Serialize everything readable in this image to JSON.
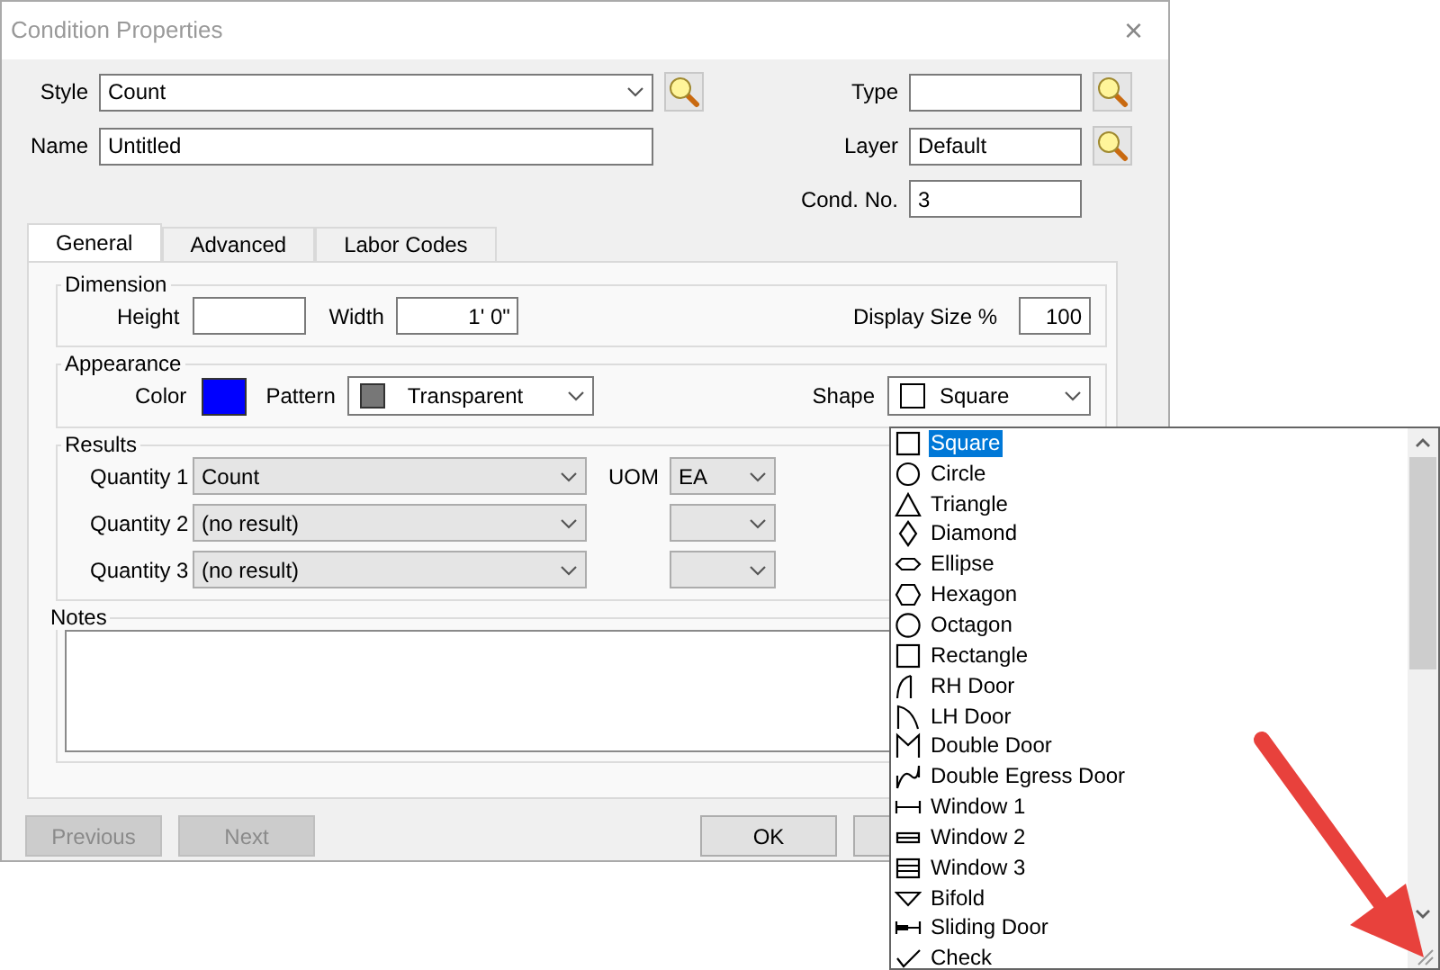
{
  "window": {
    "title": "Condition Properties",
    "close": "×"
  },
  "style": {
    "label": "Style",
    "value": "Count"
  },
  "name": {
    "label": "Name",
    "value": "Untitled"
  },
  "type": {
    "label": "Type"
  },
  "layer": {
    "label": "Layer",
    "value": "Default"
  },
  "cond_no": {
    "label": "Cond. No.",
    "value": "3"
  },
  "tabs": [
    {
      "label": "General",
      "selected": true
    },
    {
      "label": "Advanced",
      "selected": false
    },
    {
      "label": "Labor Codes",
      "selected": false
    }
  ],
  "dimension": {
    "title": "Dimension",
    "height": {
      "label": "Height"
    },
    "width": {
      "label": "Width",
      "value": "1' 0\""
    },
    "display_size": {
      "label": "Display Size %",
      "value": "100"
    }
  },
  "appearance": {
    "title": "Appearance",
    "color_label": "Color",
    "color": "#0000ff",
    "pattern": {
      "label": "Pattern",
      "value": "Transparent"
    },
    "shape": {
      "label": "Shape",
      "value": "Square"
    }
  },
  "results": {
    "title": "Results",
    "uom_label": "UOM",
    "rows": [
      {
        "label": "Quantity 1",
        "value": "Count",
        "uom": "EA"
      },
      {
        "label": "Quantity 2",
        "value": "(no result)"
      },
      {
        "label": "Quantity 3",
        "value": "(no result)"
      }
    ]
  },
  "notes": {
    "title": "Notes"
  },
  "buttons": [
    {
      "label": "Previous",
      "disabled": true
    },
    {
      "label": "Next",
      "disabled": true
    },
    {
      "label": "OK",
      "disabled": false
    },
    {
      "disabled": false
    }
  ],
  "shape_list": {
    "items": [
      {
        "label": "Square",
        "kind": "square",
        "selected": true
      },
      {
        "label": "Circle",
        "kind": "circle",
        "selected": false
      },
      {
        "label": "Triangle",
        "kind": "triangle",
        "selected": false
      },
      {
        "label": "Diamond",
        "kind": "diamond",
        "selected": false
      },
      {
        "label": "Ellipse",
        "kind": "ellipse",
        "selected": false
      },
      {
        "label": "Hexagon",
        "kind": "hexagon",
        "selected": false
      },
      {
        "label": "Octagon",
        "kind": "octagon",
        "selected": false
      },
      {
        "label": "Rectangle",
        "kind": "rectangle",
        "selected": false
      },
      {
        "label": "RH Door",
        "kind": "rh-door",
        "selected": false
      },
      {
        "label": "LH Door",
        "kind": "lh-door",
        "selected": false
      },
      {
        "label": "Double Door",
        "kind": "double-door",
        "selected": false
      },
      {
        "label": "Double Egress Door",
        "kind": "double-egress-door",
        "selected": false
      },
      {
        "label": "Window 1",
        "kind": "window-1",
        "selected": false
      },
      {
        "label": "Window 2",
        "kind": "window-2",
        "selected": false
      },
      {
        "label": "Window 3",
        "kind": "window-3",
        "selected": false
      },
      {
        "label": "Bifold",
        "kind": "bifold",
        "selected": false
      },
      {
        "label": "Sliding Door",
        "kind": "sliding-door",
        "selected": false
      },
      {
        "label": "Check",
        "kind": "check",
        "selected": false
      }
    ]
  }
}
